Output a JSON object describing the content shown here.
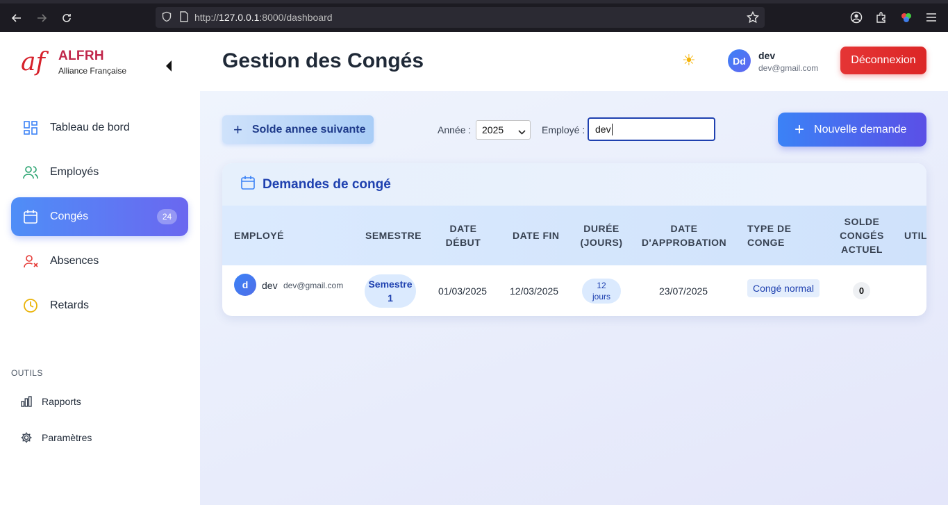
{
  "browser": {
    "url_prefix": "http://",
    "url_host": "127.0.0.1",
    "url_path": ":8000/dashboard"
  },
  "sidebar": {
    "brand_logo": "af",
    "brand_title": "ALFRH",
    "brand_subtitle": "Alliance Française",
    "items": [
      {
        "label": "Tableau de bord",
        "icon": "dashboard-icon"
      },
      {
        "label": "Employés",
        "icon": "users-icon"
      },
      {
        "label": "Congés",
        "icon": "calendar-icon",
        "badge": "24",
        "active": true
      },
      {
        "label": "Absences",
        "icon": "user-x-icon"
      },
      {
        "label": "Retards",
        "icon": "clock-icon"
      }
    ],
    "tools_label": "OUTILS",
    "tools": [
      {
        "label": "Rapports",
        "icon": "bar-chart-icon"
      },
      {
        "label": "Paramètres",
        "icon": "settings-icon"
      }
    ]
  },
  "header": {
    "title": "Gestion des Congés",
    "theme_icon": "☀",
    "user_initials": "Dd",
    "user_name": "dev",
    "user_email": "dev@gmail.com",
    "logout_label": "Déconnexion"
  },
  "toolbar": {
    "solde_label": "Solde annee suivante",
    "year_label": "Année :",
    "year_value": "2025",
    "employee_label": "Employé :",
    "employee_value": "dev",
    "new_label": "Nouvelle demande"
  },
  "table": {
    "title": "Demandes de congé",
    "headers": [
      "EMPLOYÉ",
      "SEMESTRE",
      "DATE DÉBUT",
      "DATE FIN",
      "DURÉE (JOURS)",
      "DATE D'APPROBATION",
      "TYPE DE CONGE",
      "SOLDE CONGÉS ACTUEL",
      "UTIL"
    ],
    "header_lines": {
      "employe": "EMPLOYÉ",
      "semestre": "SEMESTRE",
      "date_debut_1": "DATE",
      "date_debut_2": "DÉBUT",
      "date_fin": "DATE FIN",
      "duree_1": "DURÉE",
      "duree_2": "(JOURS)",
      "approbation_1": "DATE",
      "approbation_2": "D'APPROBATION",
      "type_1": "TYPE DE",
      "type_2": "CONGE",
      "solde_1": "SOLDE",
      "solde_2": "CONGÉS",
      "solde_3": "ACTUEL",
      "util": "UTIL"
    },
    "rows": [
      {
        "avatar": "d",
        "name": "dev",
        "email": "dev@gmail.com",
        "semestre_1": "Semestre",
        "semestre_2": "1",
        "date_debut": "01/03/2025",
        "date_fin": "12/03/2025",
        "duree_1": "12",
        "duree_2": "jours",
        "date_approbation": "23/07/2025",
        "type": "Congé normal",
        "solde": "0"
      }
    ]
  }
}
